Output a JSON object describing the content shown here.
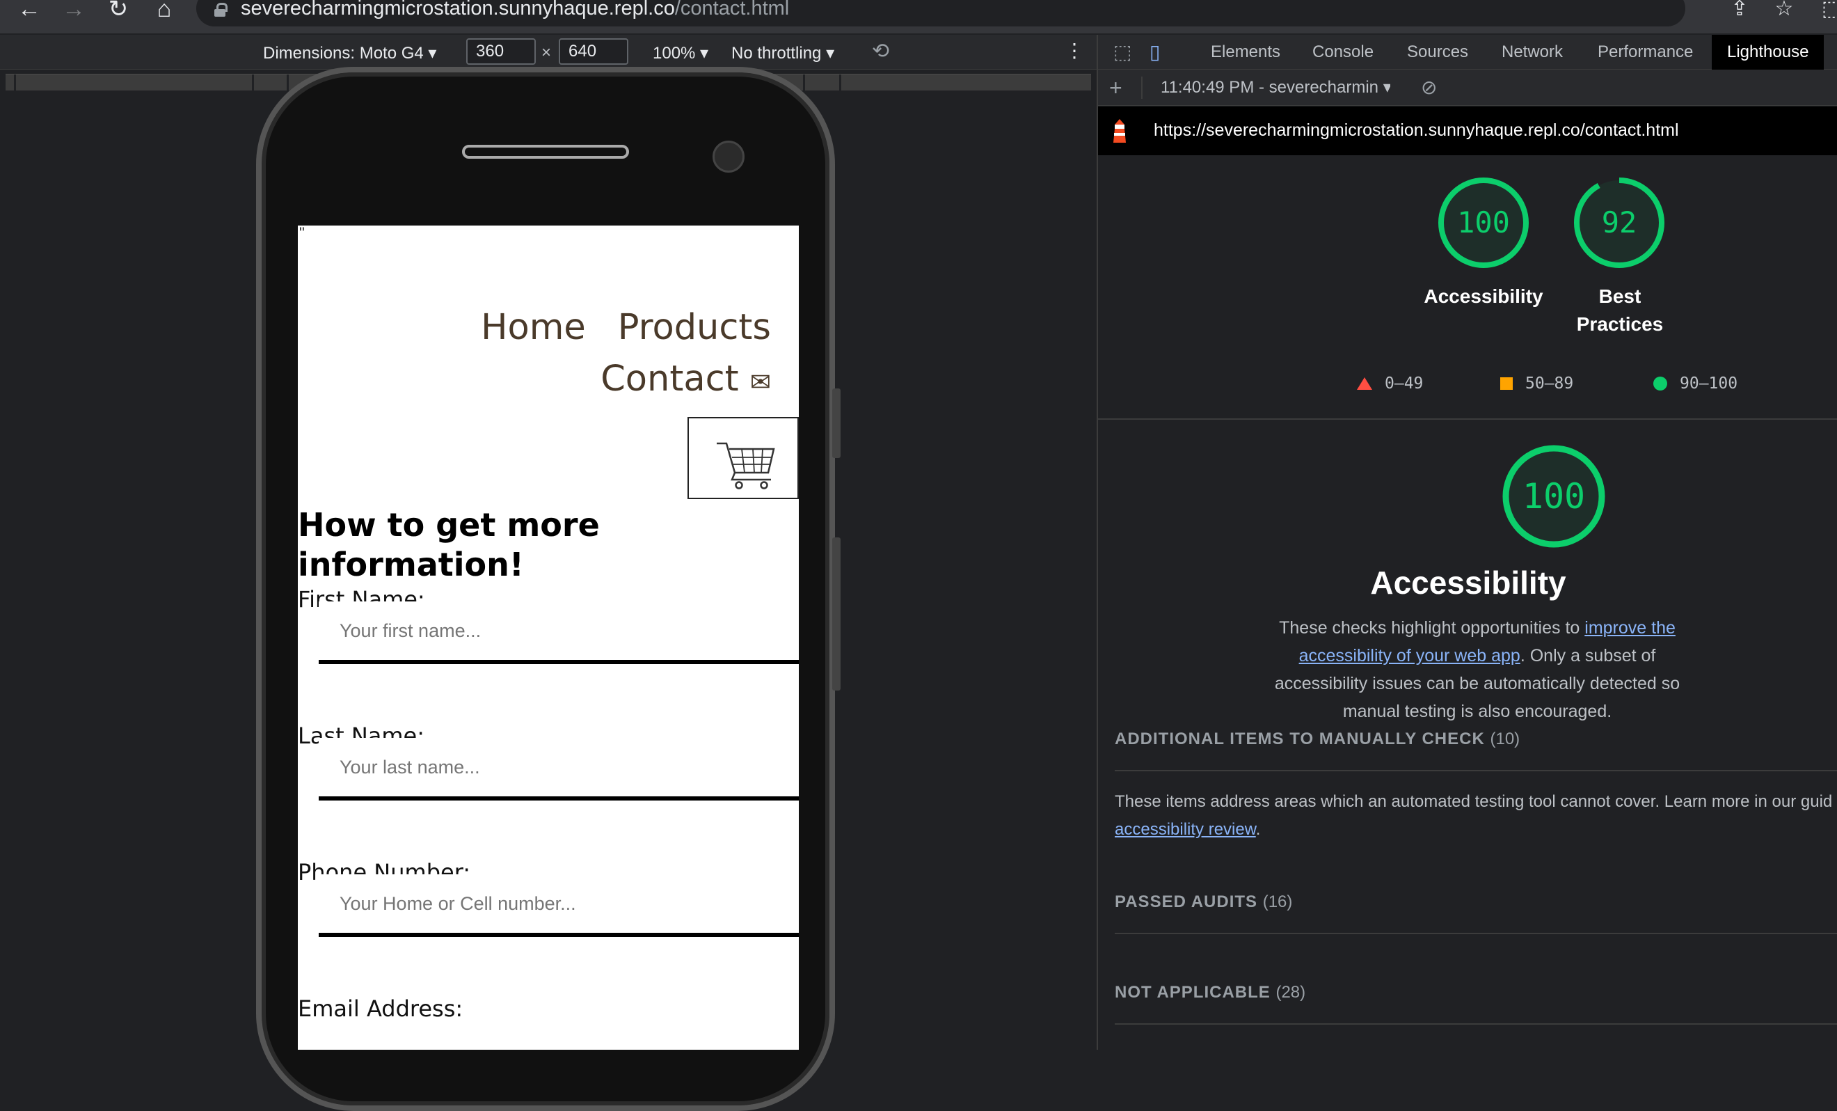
{
  "browser": {
    "url_host": "severecharmingmicrostation.sunnyhaque.repl.co",
    "url_path": "/contact.html"
  },
  "device_toolbar": {
    "dimensions_label": "Dimensions: Moto G4",
    "width": "360",
    "height": "640",
    "times": "×",
    "zoom": "100%",
    "throttling": "No throttling"
  },
  "site": {
    "quote_mark": "\"",
    "nav": {
      "home": "Home",
      "products": "Products",
      "contact": "Contact"
    },
    "heading": "How to get more information!",
    "fields": [
      {
        "label": "First Name:",
        "placeholder": "Your first name..."
      },
      {
        "label": "Last Name:",
        "placeholder": "Your last name..."
      },
      {
        "label": "Phone Number:",
        "placeholder": "Your Home or Cell number..."
      },
      {
        "label": "Email Address:",
        "placeholder": ""
      }
    ]
  },
  "devtools": {
    "tabs": [
      "Elements",
      "Console",
      "Sources",
      "Network",
      "Performance",
      "Lighthouse"
    ],
    "active_tab": "Lighthouse",
    "report_selector": "11:40:49 PM - severecharmin",
    "report_url": "https://severecharmingmicrostation.sunnyhaque.repl.co/contact.html",
    "gauges": [
      {
        "score": "100",
        "label": "Accessibility",
        "value": 1.0
      },
      {
        "score": "92",
        "label": "Best Practices",
        "value": 0.92
      }
    ],
    "legend": [
      {
        "range": "0–49",
        "color": "#ff4e42"
      },
      {
        "range": "50–89",
        "color": "#ffa400"
      },
      {
        "range": "90–100",
        "color": "#0cce6b"
      }
    ],
    "category": {
      "score": "100",
      "value": 1.0,
      "title": "Accessibility",
      "desc_before": "These checks highlight opportunities to ",
      "desc_link": "improve the accessibility of your web app",
      "desc_after": ". Only a subset of accessibility issues can be automatically detected so manual testing is also encouraged."
    },
    "groups": {
      "manual": {
        "title": "ADDITIONAL ITEMS TO MANUALLY CHECK",
        "count": "(10)"
      },
      "manual_text_before": "These items address areas which an automated testing tool cannot cover. Learn more in our guid",
      "manual_link": "accessibility review",
      "manual_text_after": ".",
      "passed": {
        "title": "PASSED AUDITS",
        "count": "(16)"
      },
      "not_applicable": {
        "title": "NOT APPLICABLE",
        "count": "(28)"
      }
    }
  },
  "colors": {
    "pass_green": "#0cce6b",
    "devtools_bg": "#202124",
    "link_blue": "#8ab4f8"
  }
}
